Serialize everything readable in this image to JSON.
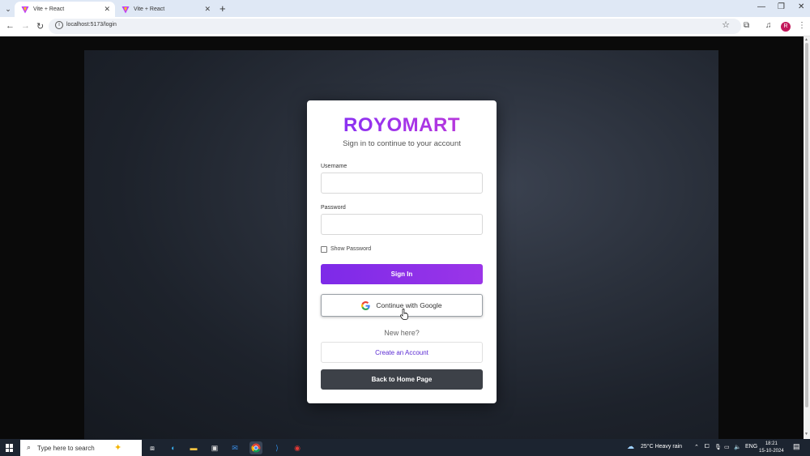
{
  "browser": {
    "tabs": [
      {
        "title": "Vite + React",
        "active": true
      },
      {
        "title": "Vite + React",
        "active": false
      }
    ],
    "url": "localhost:5173/login",
    "profile_initial": "R"
  },
  "login": {
    "brand": "ROYOMART",
    "subtitle": "Sign in to continue to your account",
    "username_label": "Username",
    "username_value": "",
    "password_label": "Password",
    "password_value": "",
    "show_password_label": "Show Password",
    "show_password_checked": false,
    "signin_label": "Sign In",
    "google_label": "Continue with Google",
    "new_here": "New here?",
    "create_account_label": "Create an Account",
    "back_home_label": "Back to Home Page",
    "colors": {
      "brand_gradient_start": "#7b2ff7",
      "brand_gradient_end": "#c23bd4",
      "signin_bg": "#8a30e8",
      "home_bg": "#3d4148",
      "link": "#5b2bd3"
    }
  },
  "taskbar": {
    "search_placeholder": "Type here to search",
    "weather": "25°C  Heavy rain",
    "language": "ENG",
    "time": "18:21",
    "date": "15-10-2024"
  }
}
